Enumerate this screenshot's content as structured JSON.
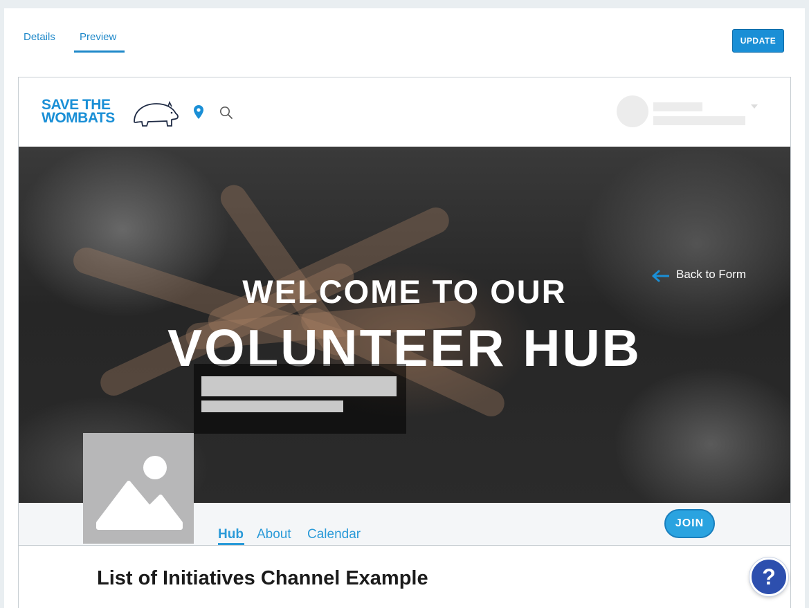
{
  "tabs": [
    {
      "label": "Details",
      "active": false
    },
    {
      "label": "Preview",
      "active": true
    }
  ],
  "toolbar": {
    "update_label": "UPDATE"
  },
  "site": {
    "logo": {
      "line1": "SAVE THE",
      "line2": "WOMBATS"
    },
    "icons": {
      "location": "map-pin-icon",
      "search": "search-icon"
    }
  },
  "hero": {
    "title_line1": "WELCOME TO OUR",
    "title_line2": "VOLUNTEER HUB",
    "back_link": "Back to Form"
  },
  "hub_nav": {
    "items": [
      {
        "label": "Hub",
        "active": true
      },
      {
        "label": "About",
        "active": false
      },
      {
        "label": "Calendar",
        "active": false
      }
    ],
    "join_label": "JOIN"
  },
  "channel": {
    "title": "List of Initiatives Channel Example"
  },
  "help": {
    "label": "?"
  },
  "colors": {
    "accent": "#1e88c9",
    "join": "#2aa3e0",
    "help": "#2d4fae",
    "placeholder": "#ececec"
  }
}
